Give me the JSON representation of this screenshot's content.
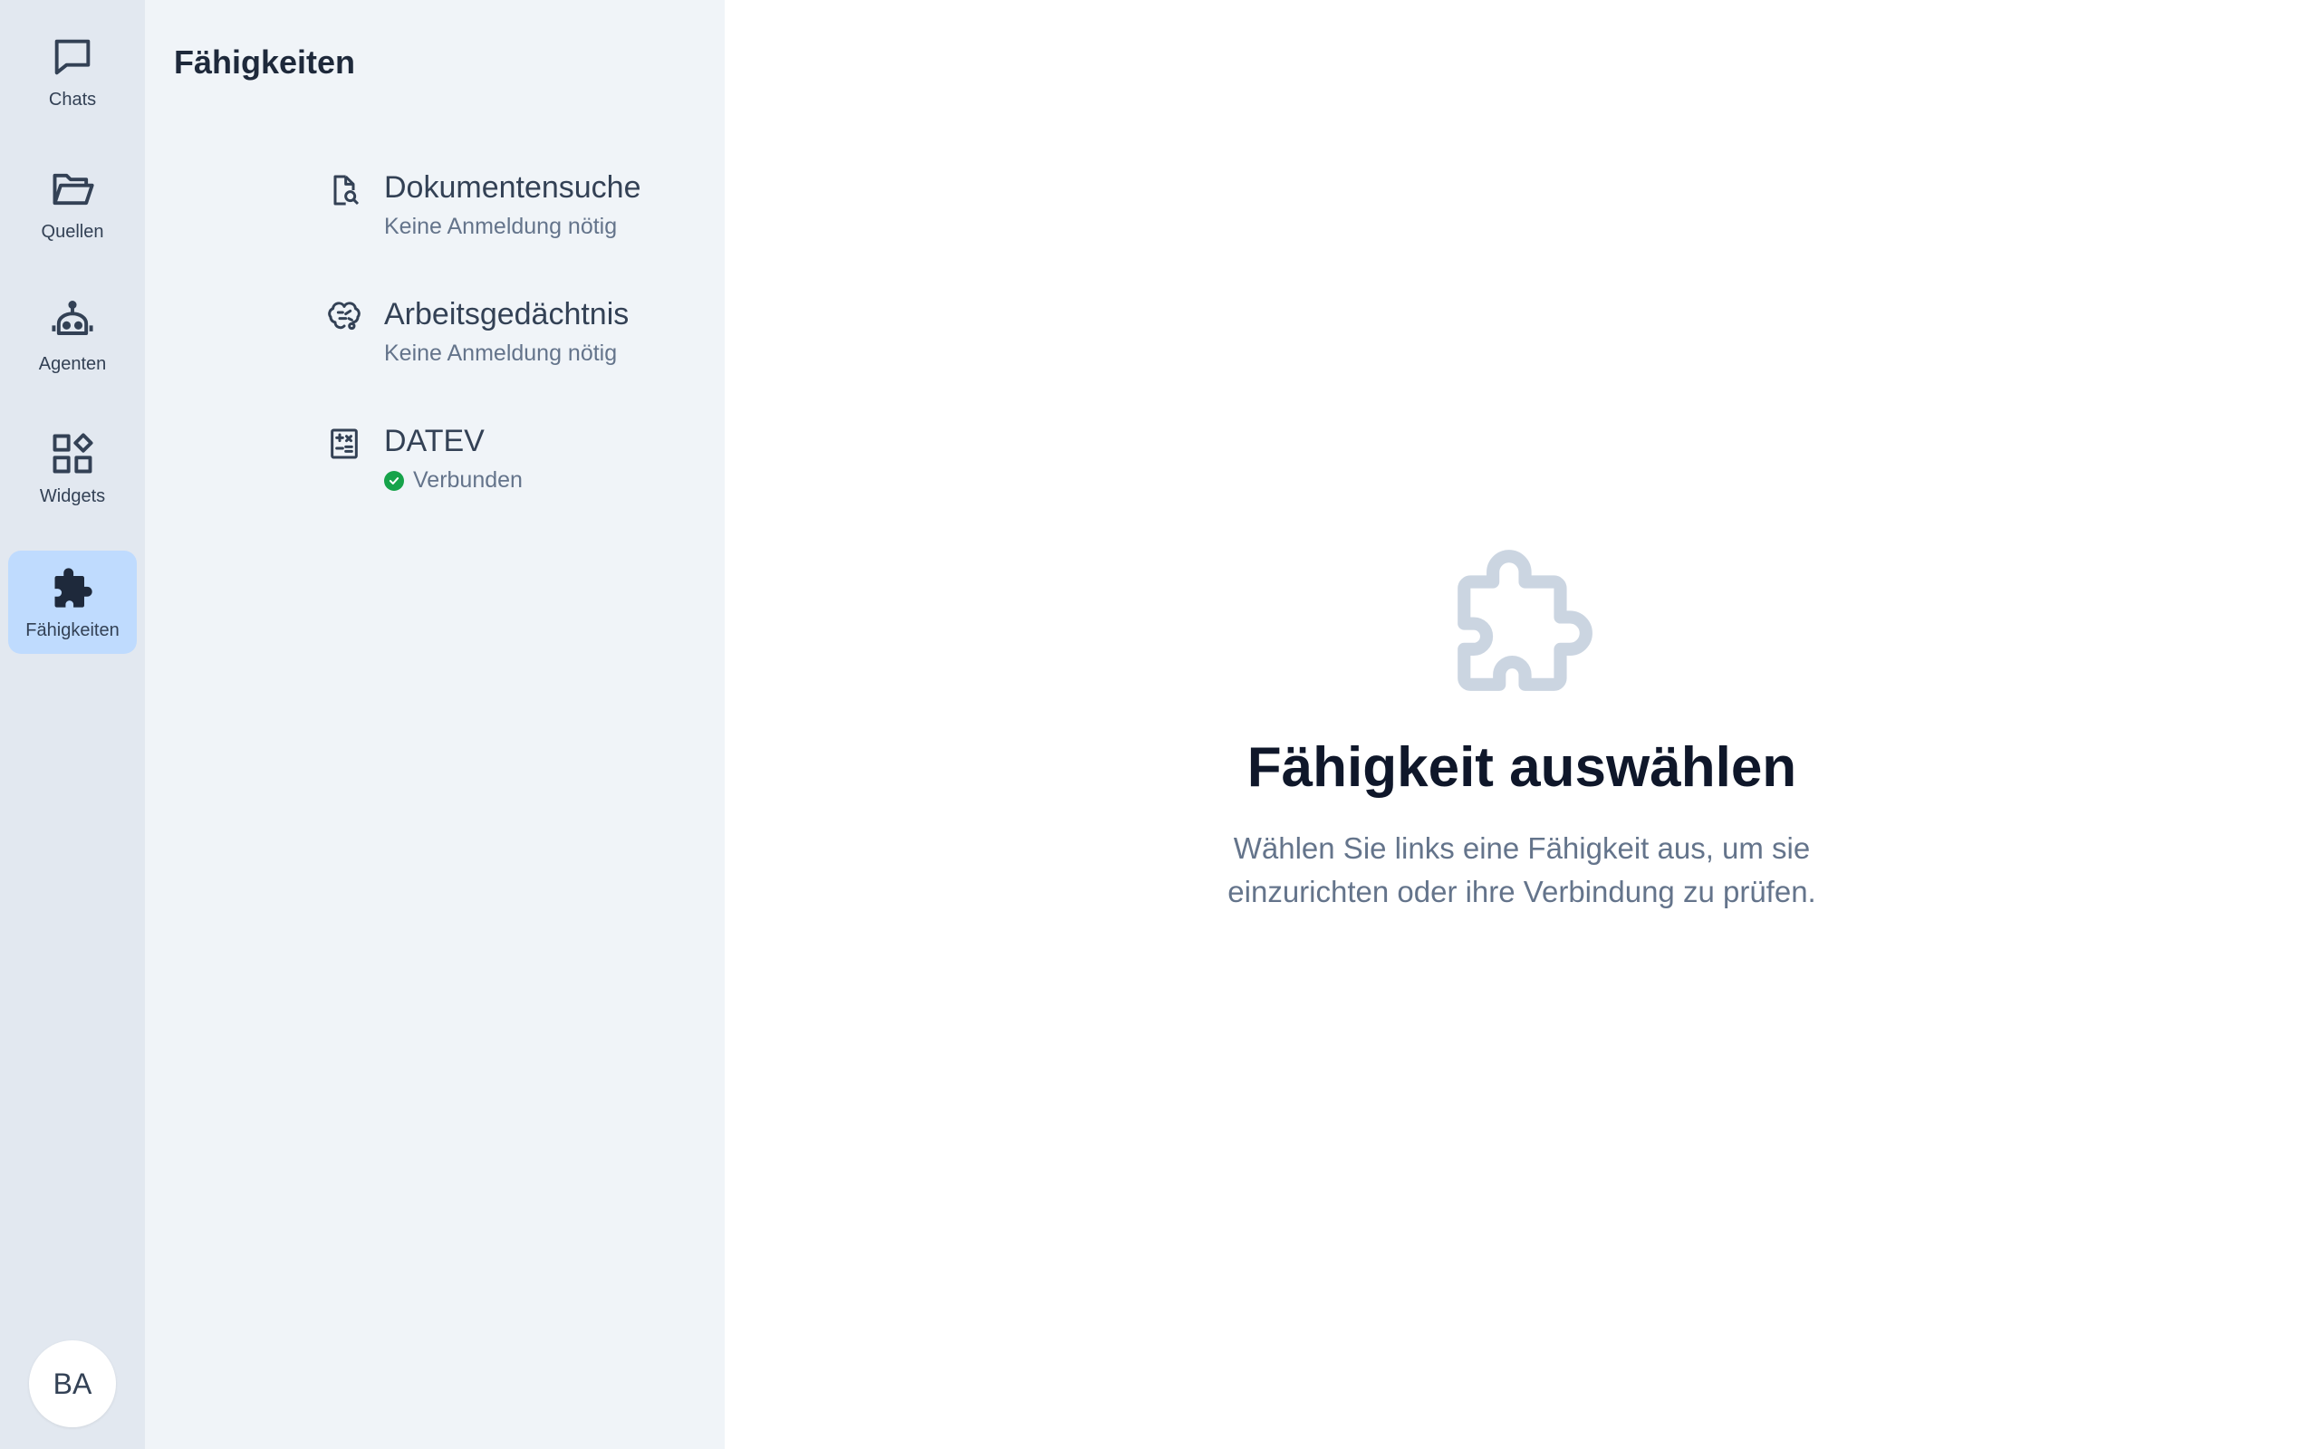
{
  "rail": {
    "items": [
      {
        "label": "Chats",
        "icon": "chat-bubble-icon"
      },
      {
        "label": "Quellen",
        "icon": "folder-open-icon"
      },
      {
        "label": "Agenten",
        "icon": "robot-icon"
      },
      {
        "label": "Widgets",
        "icon": "widgets-icon"
      },
      {
        "label": "Fähigkeiten",
        "icon": "puzzle-icon",
        "active": true
      }
    ],
    "avatar": "BA"
  },
  "panel": {
    "title": "Fähigkeiten",
    "skills": [
      {
        "name": "Dokumentensuche",
        "status": "Keine Anmeldung nötig",
        "icon": "document-search-icon"
      },
      {
        "name": "Arbeitsgedächtnis",
        "status": "Keine Anmeldung nötig",
        "icon": "brain-icon"
      },
      {
        "name": "DATEV",
        "status": "Verbunden",
        "icon": "calculator-icon",
        "connected": true
      }
    ]
  },
  "main": {
    "empty_icon": "puzzle-icon",
    "title": "Fähigkeit auswählen",
    "description": "Wählen Sie links eine Fähigkeit aus, um sie einzurichten oder ihre Verbindung zu prüfen."
  },
  "colors": {
    "rail_bg": "#e2e8f0",
    "panel_bg": "#f0f4f8",
    "active_bg": "#bfdbfe",
    "connected": "#16a34a",
    "empty_icon": "#cbd5e1"
  }
}
